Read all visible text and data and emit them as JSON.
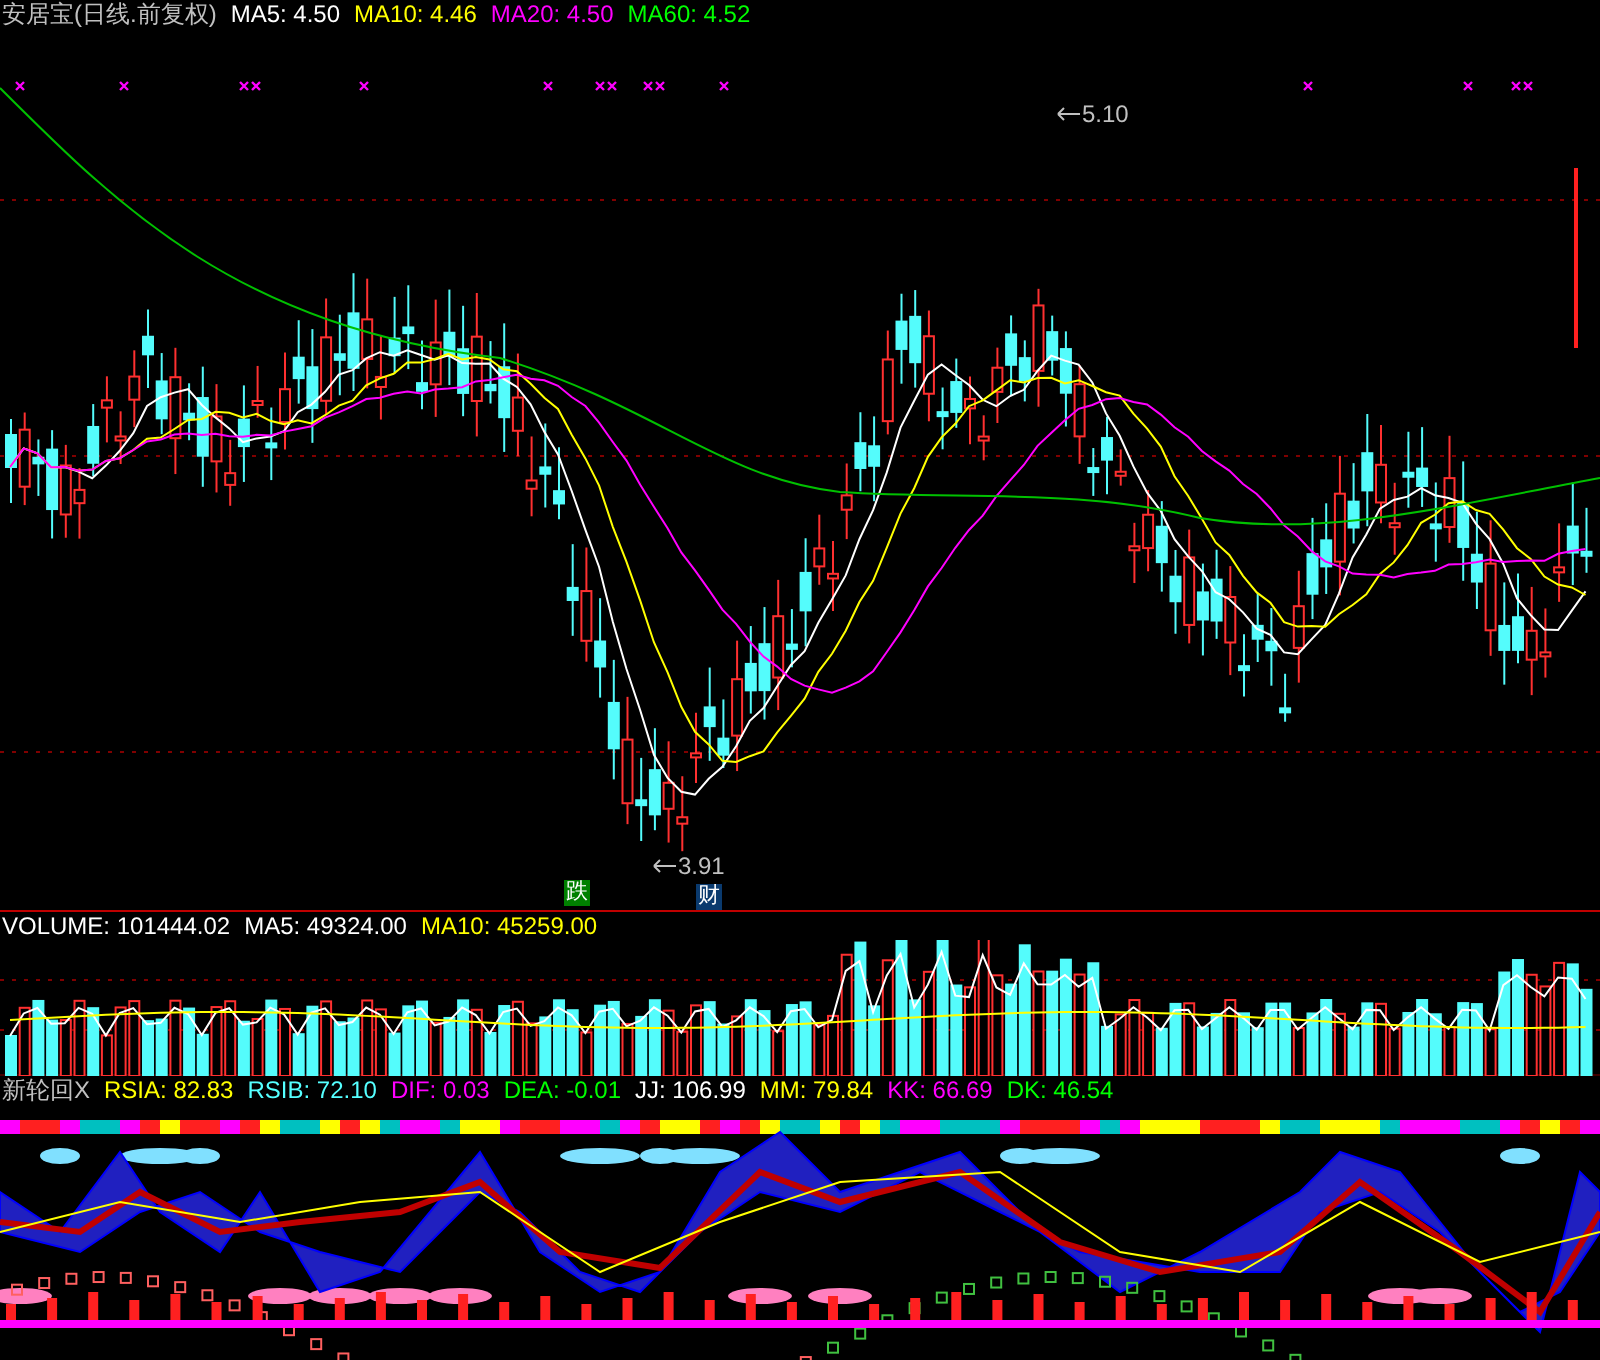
{
  "main_chart": {
    "title": "安居宝(日线.前复权)",
    "indicators": [
      {
        "label": "MA5: 4.50",
        "color": "#ffffff"
      },
      {
        "label": "MA10: 4.46",
        "color": "#ffff00"
      },
      {
        "label": "MA20: 4.50",
        "color": "#ff00ff"
      },
      {
        "label": "MA60: 4.52",
        "color": "#00ff00"
      }
    ],
    "high_label": "5.10",
    "low_label": "3.91",
    "signals": [
      {
        "text": "跌",
        "color": "#008000"
      },
      {
        "text": "财",
        "color": "#0a3a6e"
      }
    ]
  },
  "volume_chart": {
    "indicators": [
      {
        "label": "VOLUME: 101444.02",
        "color": "#ffffff"
      },
      {
        "label": "MA5: 49324.00",
        "color": "#ffffff"
      },
      {
        "label": "MA10: 45259.00",
        "color": "#ffff00"
      }
    ]
  },
  "indicator_chart": {
    "title": "新轮回X",
    "indicators": [
      {
        "label": "RSIA: 82.83",
        "color": "#ffff00"
      },
      {
        "label": "RSIB: 72.10",
        "color": "#55ffff"
      },
      {
        "label": "DIF: 0.03",
        "color": "#ff00ff"
      },
      {
        "label": "DEA: -0.01",
        "color": "#00ff00"
      },
      {
        "label": "JJ: 106.99",
        "color": "#ffffff"
      },
      {
        "label": "MM: 79.84",
        "color": "#ffff00"
      },
      {
        "label": "KK: 66.69",
        "color": "#ff00ff"
      },
      {
        "label": "DK: 46.54",
        "color": "#00ff00"
      }
    ]
  }
}
